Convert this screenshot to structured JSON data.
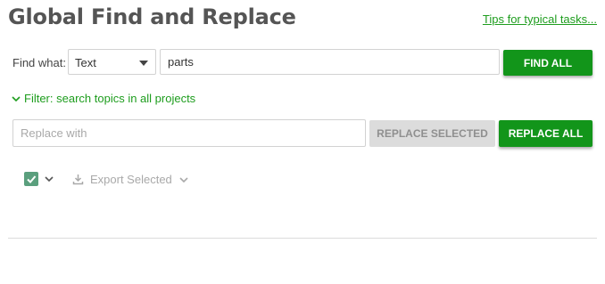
{
  "header": {
    "title": "Global Find and Replace",
    "tips_link": "Tips for typical tasks..."
  },
  "find": {
    "label": "Find what:",
    "type_selected": "Text",
    "value": "parts",
    "button": "FIND ALL"
  },
  "filter": {
    "label": "Filter: search topics in all projects"
  },
  "replace": {
    "placeholder": "Replace with",
    "value": "",
    "replace_selected_button": "REPLACE SELECTED",
    "replace_all_button": "REPLACE ALL"
  },
  "results_toolbar": {
    "select_all_checked": true,
    "export_label": "Export Selected"
  },
  "colors": {
    "accent_green": "#12951a",
    "link_green": "#1e9d1e",
    "checkbox_green": "#5a9f7d",
    "disabled_gray": "#dcdcdc"
  },
  "icons": [
    "chevron-down-icon",
    "checkmark-icon",
    "download-icon"
  ]
}
